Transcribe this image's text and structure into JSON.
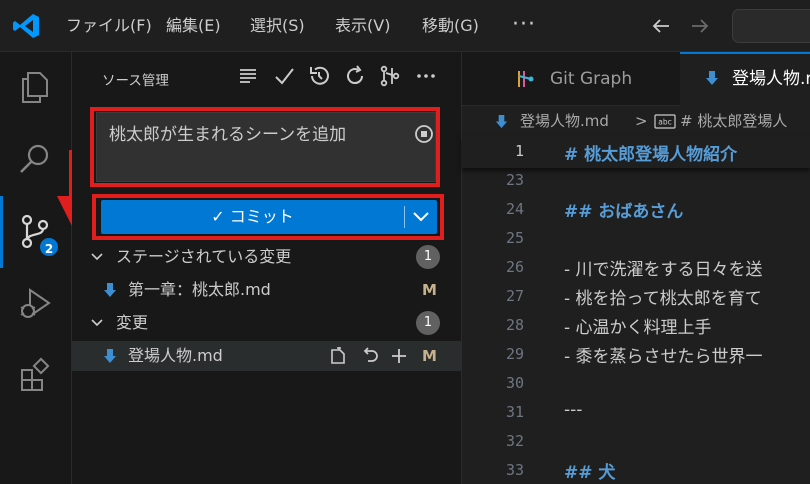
{
  "menu": {
    "items": [
      "ファイル(F)",
      "編集(E)",
      "選択(S)",
      "表示(V)",
      "移動(G)"
    ],
    "more": "···"
  },
  "activity": {
    "scm_badge": "2",
    "items": [
      "explorer-icon",
      "search-icon",
      "source-control-icon",
      "run-debug-icon",
      "extensions-icon"
    ]
  },
  "scm": {
    "title": "ソース管理",
    "message": "桃太郎が生まれるシーンを追加",
    "commit_label": "✓ コミット",
    "staged_header": "ステージされている変更",
    "staged_count": "1",
    "staged_files": [
      {
        "name": "第一章：桃太郎.md",
        "status": "M"
      }
    ],
    "changes_header": "変更",
    "changes_count": "1",
    "changed_files": [
      {
        "name": "登場人物.md",
        "status": "M"
      }
    ]
  },
  "editor": {
    "tabs": [
      {
        "label": "Git Graph",
        "active": false
      },
      {
        "label": "登場人物.md",
        "active": true
      }
    ],
    "breadcrumb": {
      "file": "登場人物.md",
      "separator": ">",
      "symbol": "# 桃太郎登場人"
    },
    "sticky": {
      "line": "1",
      "text": "# 桃太郎登場人物紹介"
    },
    "lines": [
      {
        "n": "23",
        "text": ""
      },
      {
        "n": "24",
        "text": "## おばあさん",
        "heading": true
      },
      {
        "n": "25",
        "text": ""
      },
      {
        "n": "26",
        "text": "- 川で洗濯をする日々を送"
      },
      {
        "n": "27",
        "text": "- 桃を拾って桃太郎を育て"
      },
      {
        "n": "28",
        "text": "- 心温かく料理上手"
      },
      {
        "n": "29",
        "text": "- 黍を蒸らさせたら世界一"
      },
      {
        "n": "30",
        "text": ""
      },
      {
        "n": "31",
        "text": "---"
      },
      {
        "n": "32",
        "text": ""
      },
      {
        "n": "33",
        "text": "## 犬",
        "heading": true
      },
      {
        "n": "34",
        "text": ""
      }
    ]
  },
  "colors": {
    "accent": "#0078d4",
    "annotation_red": "#e01e1e",
    "heading_blue": "#569cd6",
    "modified": "#c6b18c"
  }
}
